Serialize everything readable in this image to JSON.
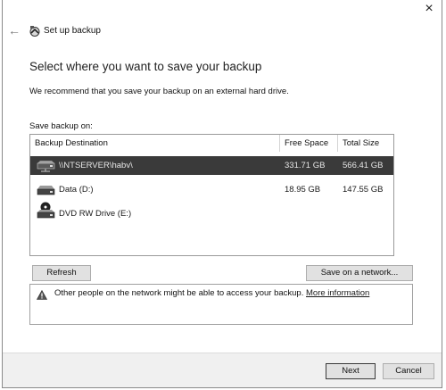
{
  "window": {
    "title": "Set up backup",
    "close_glyph": "×",
    "back_glyph": "←"
  },
  "main": {
    "heading": "Select where you want to save your backup",
    "recommendation": "We recommend that you save your backup on an external hard drive.",
    "save_on_label": "Save backup on:"
  },
  "table": {
    "columns": [
      "Backup Destination",
      "Free Space",
      "Total Size"
    ],
    "rows": [
      {
        "destination": "\\\\NTSERVER\\habv\\",
        "free": "331.71 GB",
        "total": "566.41 GB",
        "icon": "network-drive-icon",
        "selected": true
      },
      {
        "destination": "Data (D:)",
        "free": "18.95 GB",
        "total": "147.55 GB",
        "icon": "hard-drive-icon",
        "selected": false
      },
      {
        "destination": "DVD RW Drive (E:)",
        "free": "",
        "total": "",
        "icon": "dvd-drive-icon",
        "selected": false
      }
    ]
  },
  "buttons": {
    "refresh": "Refresh",
    "save_network": "Save on a network...",
    "next": "Next",
    "cancel": "Cancel"
  },
  "warning": {
    "icon": "warning-icon",
    "text": "Other people on the network might be able to access your backup.",
    "link": "More information"
  }
}
